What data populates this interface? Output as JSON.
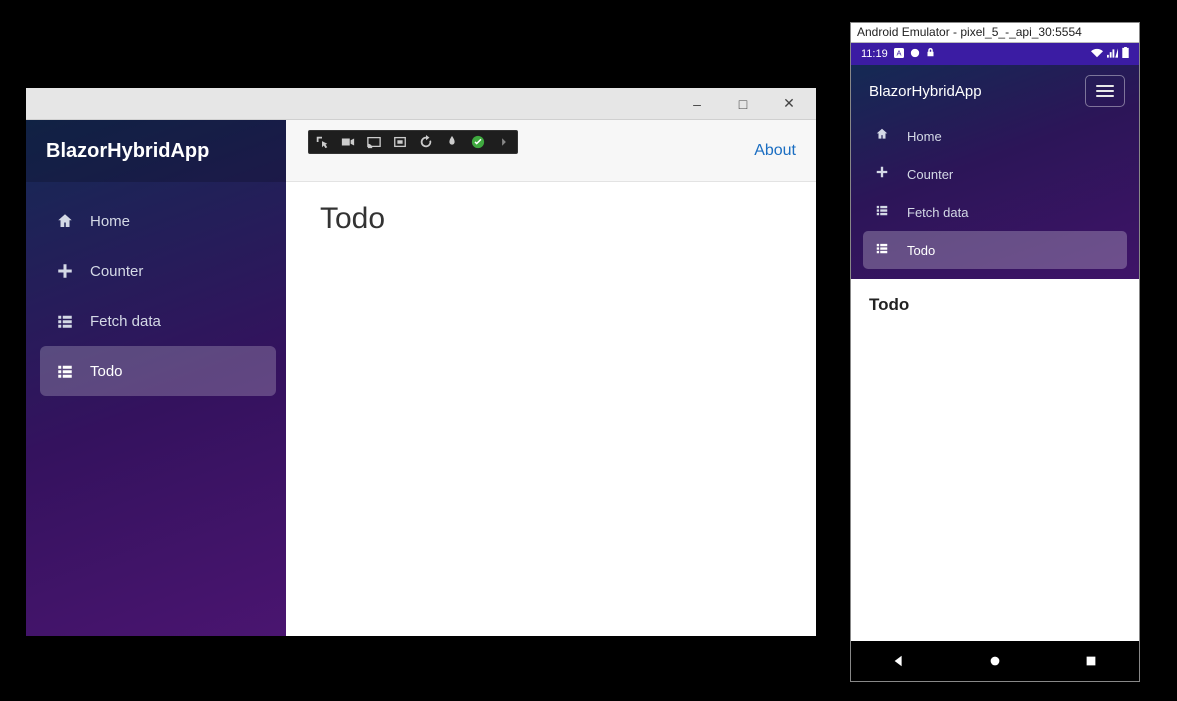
{
  "desktop": {
    "brand": "BlazorHybridApp",
    "nav": [
      {
        "label": "Home",
        "icon": "home",
        "active": false
      },
      {
        "label": "Counter",
        "icon": "plus",
        "active": false
      },
      {
        "label": "Fetch data",
        "icon": "list",
        "active": false
      },
      {
        "label": "Todo",
        "icon": "list",
        "active": true
      }
    ],
    "topbar": {
      "about": "About"
    },
    "page": {
      "heading": "Todo"
    },
    "window_controls": {
      "minimize": "–",
      "maximize": "□",
      "close": "✕"
    }
  },
  "emulator": {
    "window_title": "Android Emulator - pixel_5_-_api_30:5554",
    "status": {
      "time": "11:19",
      "right_icons": [
        "wifi",
        "signal",
        "battery"
      ]
    },
    "brand": "BlazorHybridApp",
    "nav": [
      {
        "label": "Home",
        "icon": "home",
        "active": false
      },
      {
        "label": "Counter",
        "icon": "plus",
        "active": false
      },
      {
        "label": "Fetch data",
        "icon": "list",
        "active": false
      },
      {
        "label": "Todo",
        "icon": "list",
        "active": true
      }
    ],
    "page": {
      "heading": "Todo"
    },
    "android_nav": [
      "back",
      "home",
      "recent"
    ]
  },
  "colors": {
    "sidebar_gradient_from": "#142a54",
    "sidebar_gradient_to": "#4a1570",
    "accent_link": "#1b6ec2",
    "android_status": "#3b1ca3"
  }
}
